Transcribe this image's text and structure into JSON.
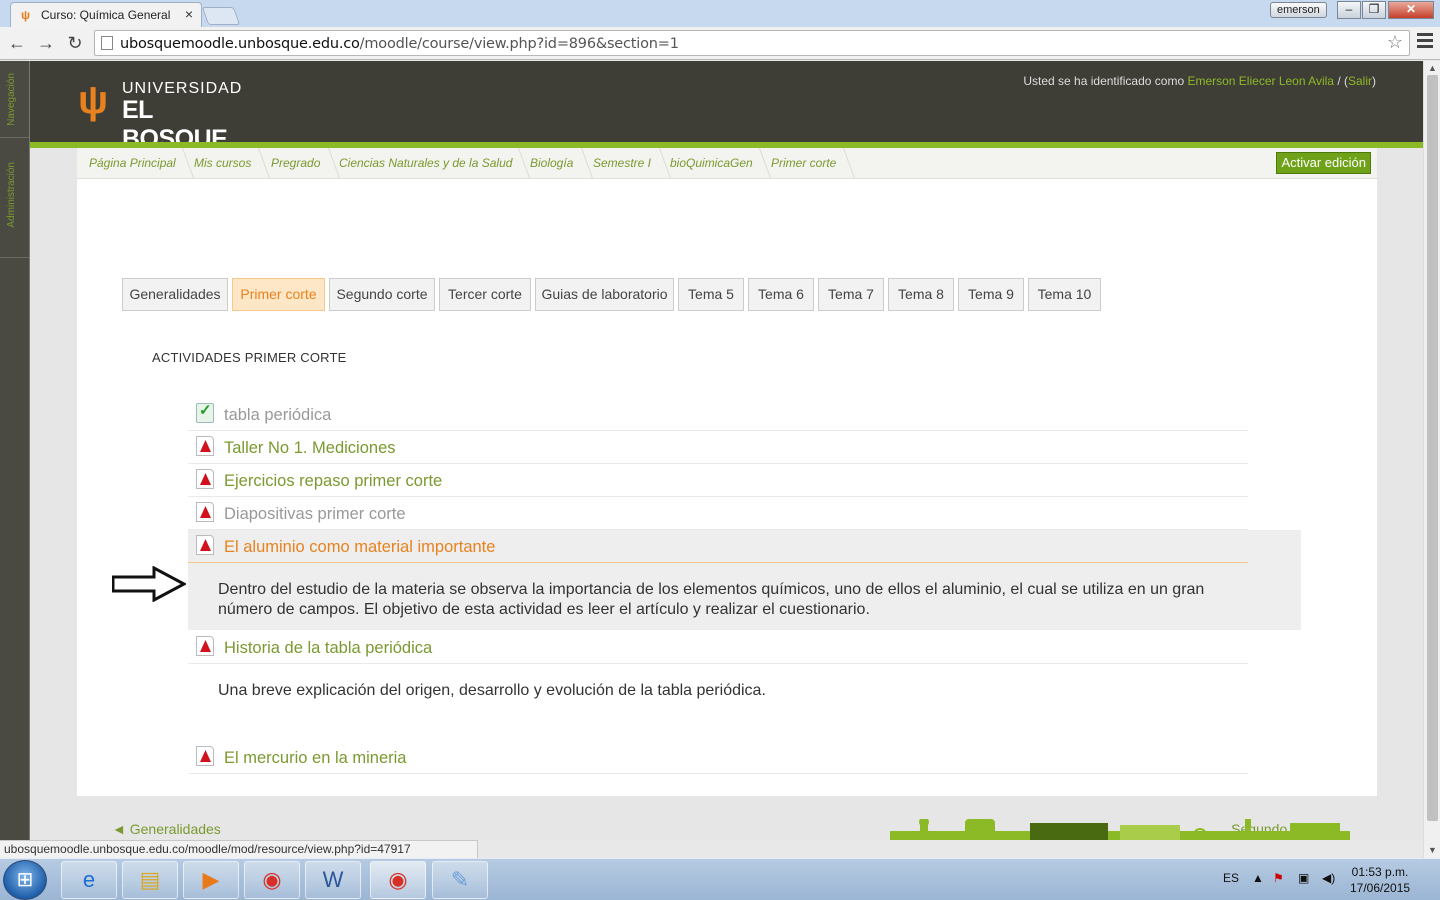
{
  "browser": {
    "tab_title": "Curso: Química General",
    "tab_close": "×",
    "user": "emerson",
    "url_host": "ubosquemoodle.unbosque.edu.co",
    "url_path": "/moodle/course/view.php?id=896&section=1",
    "status_url": "ubosquemoodle.unbosque.edu.co/moodle/mod/resource/view.php?id=47917",
    "back_icon": "back-arrow-icon",
    "forward_icon": "forward-arrow-icon",
    "reload_icon": "reload-icon",
    "star_icon": "bookmark-star-icon"
  },
  "dock": {
    "items": [
      "Navegación",
      "Administración"
    ]
  },
  "header": {
    "logo_line1": "UNIVERSIDAD",
    "logo_line2": "EL BOSQUE",
    "login_prefix": "Usted se ha identificado como ",
    "login_user": "Emerson Eliecer Leon Avila",
    "login_sep": " / (",
    "login_logout": "Salir",
    "login_suffix": ")"
  },
  "breadcrumb": [
    "Página Principal",
    "Mis cursos",
    "Pregrado",
    "Ciencias Naturales y de la Salud",
    "Biología",
    "Semestre I",
    "bioQuimicaGen",
    "Primer corte"
  ],
  "edit_button": "Activar edición",
  "section_tabs": [
    "Generalidades",
    "Primer corte",
    "Segundo corte",
    "Tercer corte",
    "Guias de laboratorio",
    "Tema 5",
    "Tema 6",
    "Tema 7",
    "Tema 8",
    "Tema 9",
    "Tema 10"
  ],
  "active_tab": "Primer corte",
  "section_title": "ACTIVIDADES PRIMER CORTE",
  "activities": [
    {
      "name": "tabla periódica",
      "icon": "checkbox-icon"
    },
    {
      "name": "Taller No 1. Mediciones",
      "icon": "pdf-icon"
    },
    {
      "name": "Ejercicios repaso primer corte",
      "icon": "pdf-icon"
    },
    {
      "name": "Diapositivas primer corte",
      "icon": "pdf-icon"
    },
    {
      "name": "El aluminio como material importante",
      "icon": "pdf-icon",
      "description_1": "Dentro del estudio de la materia se observa la importancia de los elementos químicos, uno de ellos el aluminio, el cual se utiliza en un gran",
      "description_2": "número de campos. El objetivo de esta actividad es leer el artículo y realizar el cuestionario."
    },
    {
      "name": "Historia de la tabla periódica",
      "icon": "pdf-icon",
      "description_1": "Una breve explicación del origen, desarrollo y evolución de la tabla periódica."
    },
    {
      "name": "El mercurio en la mineria",
      "icon": "pdf-icon"
    }
  ],
  "nav": {
    "prev": "◄ Generalidades",
    "next": "Segundo corte ►"
  },
  "taskbar": {
    "lang": "ES",
    "time": "01:53 p.m.",
    "date": "17/06/2015",
    "apps": [
      "internet-explorer-icon",
      "file-explorer-icon",
      "media-player-icon",
      "chrome-icon",
      "word-icon",
      "chrome-icon",
      "paint-icon"
    ]
  },
  "colors": {
    "accent_green": "#7a9a30",
    "accent_orange": "#e8821e",
    "header_dark": "#3e3e37"
  }
}
